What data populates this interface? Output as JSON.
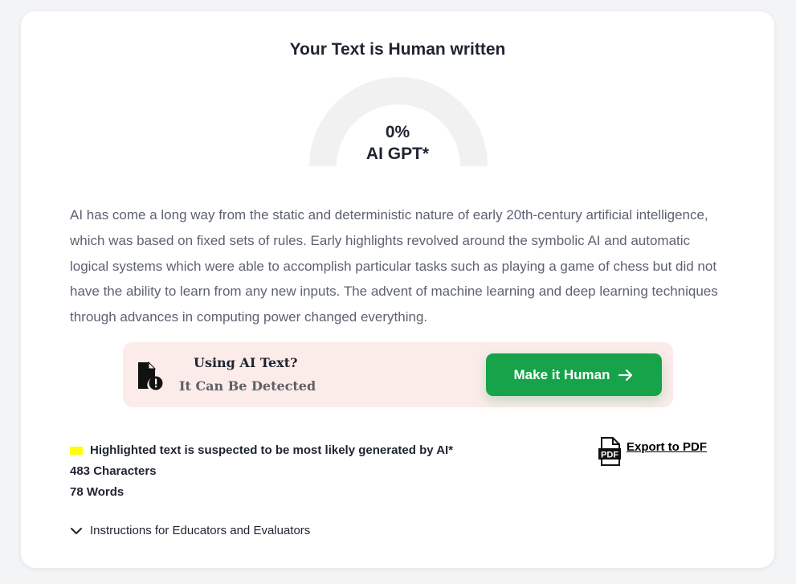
{
  "result": {
    "title": "Your Text is Human written",
    "ai_percent": 0,
    "ai_percent_label": "0%",
    "ai_label": "AI GPT*"
  },
  "analyzed_text": "AI has come a long way from the static and deterministic nature of early 20th-century artificial intelligence, which was based on fixed sets of rules. Early highlights revolved around the symbolic AI and automatic logical systems which were able to accomplish particular tasks such as playing a game of chess but did not have the ability to learn from any new inputs. The advent of machine learning and deep learning techniques through advances in computing power changed everything.",
  "promo": {
    "icon": "document-alert-icon",
    "title": "Using AI Text?",
    "subtitle": "It Can Be Detected",
    "button_label": "Make it Human",
    "button_icon": "arrow-right-icon"
  },
  "legend": {
    "highlight_color": "#ffff00",
    "text": "Highlighted text is suspected to be most likely generated by AI*"
  },
  "stats": {
    "characters": "483 Characters",
    "words": "78 Words"
  },
  "export": {
    "icon": "pdf-file-icon",
    "icon_text": "PDF",
    "label": "Export to PDF"
  },
  "instructions": {
    "icon": "chevron-down-icon",
    "label": "Instructions for Educators and Evaluators"
  },
  "colors": {
    "accent_green": "#16a34a",
    "gauge_track": "#f1f1f1",
    "promo_bg": "#fbecea"
  }
}
